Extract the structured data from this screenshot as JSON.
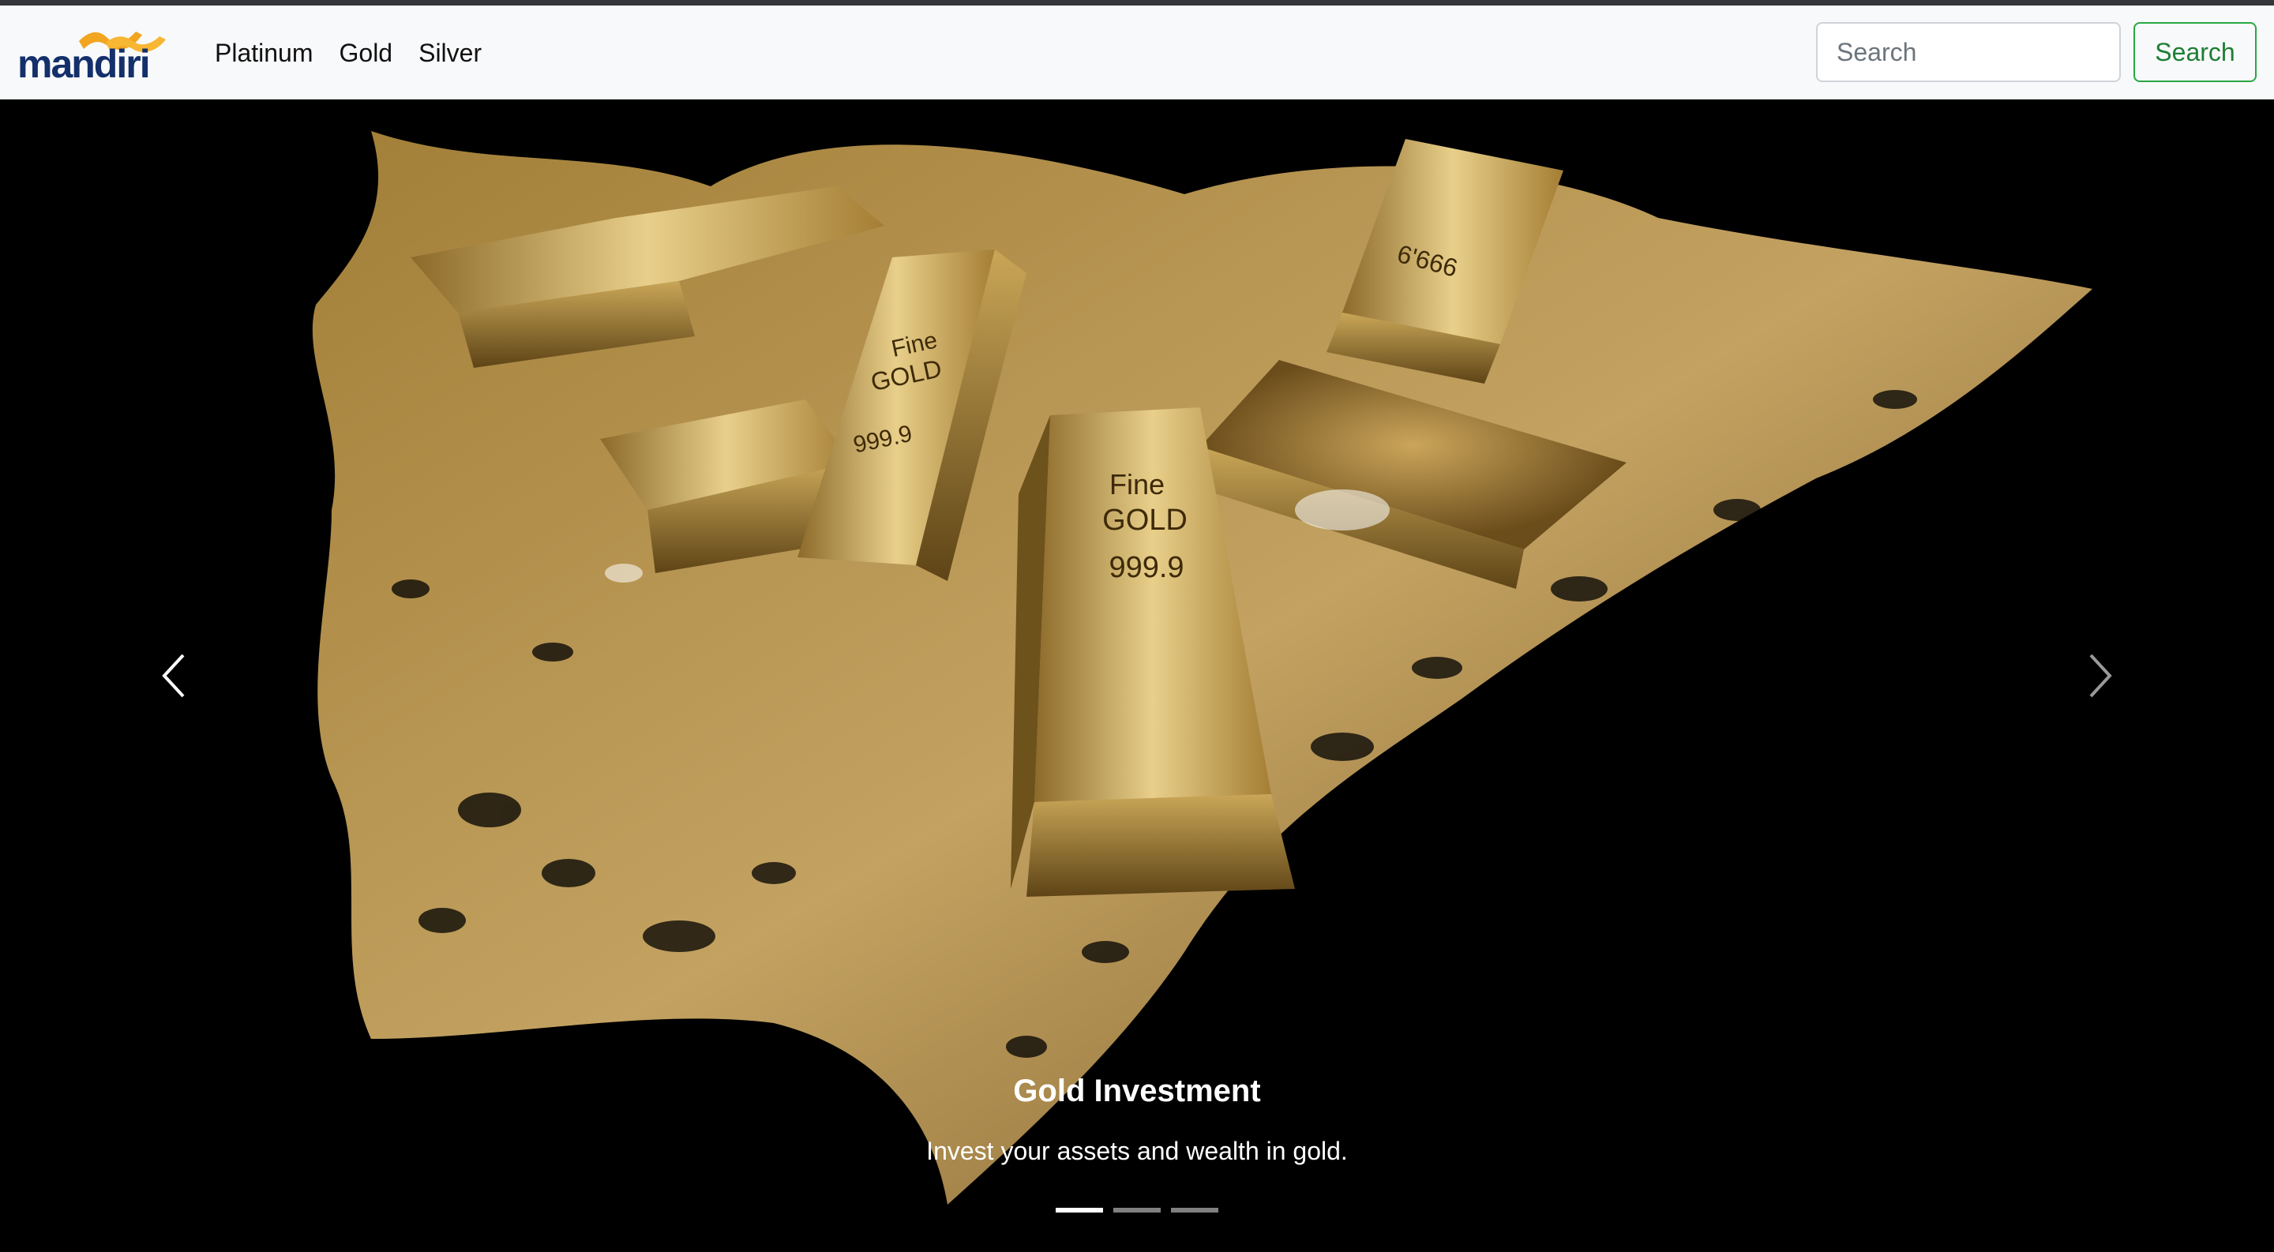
{
  "brand": {
    "name": "mandiri",
    "logo_icon": "mandiri-wave-logo",
    "colors": {
      "text": "#14306b",
      "wave": "#f2a51f"
    }
  },
  "nav": {
    "items": [
      {
        "label": "Platinum"
      },
      {
        "label": "Gold"
      },
      {
        "label": "Silver"
      }
    ]
  },
  "search": {
    "placeholder": "Search",
    "value": "",
    "button_label": "Search",
    "button_color": "#28a745"
  },
  "carousel": {
    "slides": [
      {
        "title": "Gold Investment",
        "text": "Invest your assets and wealth in gold.",
        "image": "gold bars splashing in liquid gold on black background",
        "bar_marks": [
          "Fine",
          "GOLD",
          "999.9",
          "6'666"
        ]
      }
    ],
    "active_index": 0,
    "indicator_count": 3,
    "prev_icon": "chevron-left-icon",
    "next_icon": "chevron-right-icon"
  }
}
